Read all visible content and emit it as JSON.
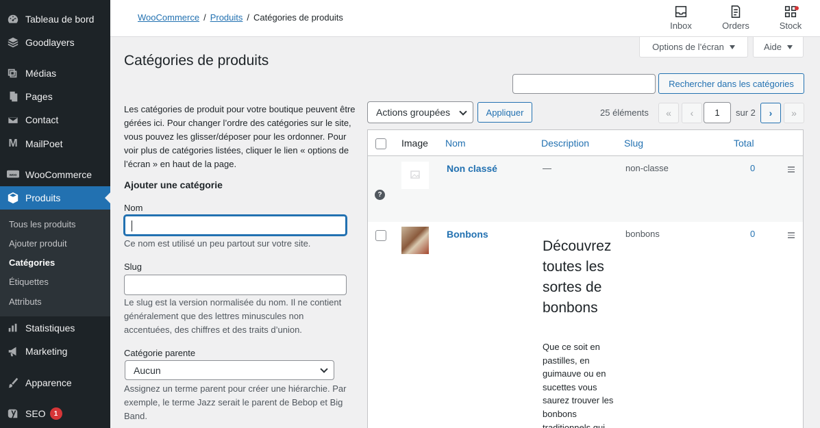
{
  "sidebar": {
    "items": [
      {
        "label": "Tableau de bord",
        "icon": "dashboard-icon"
      },
      {
        "label": "Goodlayers",
        "icon": "layers-icon"
      },
      {
        "label": "Médias",
        "icon": "media-icon"
      },
      {
        "label": "Pages",
        "icon": "pages-icon"
      },
      {
        "label": "Contact",
        "icon": "mail-icon"
      },
      {
        "label": "MailPoet",
        "icon": "mailpoet-icon"
      },
      {
        "label": "WooCommerce",
        "icon": "woo-icon"
      },
      {
        "label": "Produits",
        "icon": "product-box-icon"
      },
      {
        "label": "Statistiques",
        "icon": "bar-chart-icon"
      },
      {
        "label": "Marketing",
        "icon": "megaphone-icon"
      },
      {
        "label": "Apparence",
        "icon": "brush-icon"
      },
      {
        "label": "SEO",
        "icon": "yoast-icon",
        "badge": "1"
      }
    ],
    "submenu": [
      "Tous les produits",
      "Ajouter produit",
      "Catégories",
      "Étiquettes",
      "Attributs"
    ],
    "submenu_current": "Catégories"
  },
  "breadcrumb": {
    "woocommerce": "WooCommerce",
    "sep1": "/",
    "produits": "Produits",
    "sep2": "/",
    "current": "Catégories de produits"
  },
  "top_actions": {
    "inbox": "Inbox",
    "orders": "Orders",
    "stock": "Stock"
  },
  "screen_options": {
    "options": "Options de l’écran",
    "help": "Aide"
  },
  "page_title": "Catégories de produits",
  "form": {
    "intro": "Les catégories de produit pour votre boutique peuvent être gérées ici. Pour changer l’ordre des catégories sur le site, vous pouvez les glisser/déposer pour les ordonner. Pour voir plus de catégories listées, cliquer le lien « options de l’écran » en haut de la page.",
    "heading": "Ajouter une catégorie",
    "name_label": "Nom",
    "name_hint": "Ce nom est utilisé un peu partout sur votre site.",
    "slug_label": "Slug",
    "slug_hint": "Le slug est la version normalisée du nom. Il ne contient généralement que des lettres minuscules non accentuées, des chiffres et des traits d’union.",
    "parent_label": "Catégorie parente",
    "parent_value": "Aucun",
    "parent_hint": "Assignez un terme parent pour créer une hiérarchie. Par exemple, le terme Jazz serait le parent de Bebop et Big Band."
  },
  "search": {
    "button": "Rechercher dans les catégories",
    "value": ""
  },
  "bulk": {
    "select": "Actions groupées",
    "apply": "Appliquer"
  },
  "pagination": {
    "count": "25 éléments",
    "first": "«",
    "prev": "‹",
    "current": "1",
    "of": "sur 2",
    "next": "›",
    "last": "»"
  },
  "table": {
    "headers": {
      "image": "Image",
      "name": "Nom",
      "description": "Description",
      "slug": "Slug",
      "total": "Total"
    },
    "rows": [
      {
        "name": "Non classé",
        "description": "—",
        "slug": "non-classe",
        "total": "0"
      },
      {
        "name": "Bonbons",
        "description_title": "Découvrez toutes les sortes de bonbons",
        "description_body": "Que ce soit en pastilles, en guimauve ou en sucettes vous saurez trouver les bonbons traditionnels qui",
        "slug": "bonbons",
        "total": "0"
      }
    ]
  },
  "colors": {
    "accent": "#2271b1",
    "sidebar_bg": "#1d2327",
    "badge": "#d63638"
  }
}
